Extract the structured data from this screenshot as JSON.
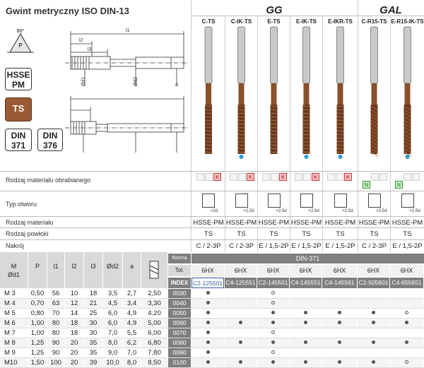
{
  "title": "Gwint metryczny ISO DIN-13",
  "badges": {
    "material": "HSSE\nPM",
    "coating": "TS",
    "din_a": "DIN\n371",
    "din_b": "DIN\n376"
  },
  "diagram_labels": {
    "angle": "60°",
    "pitch": "P",
    "l1": "l1",
    "l2": "l2",
    "l3": "l3",
    "d1": "Ød1",
    "d2": "Ød2",
    "a": "a"
  },
  "groups": [
    {
      "label": "GG"
    },
    {
      "label": "GAL"
    }
  ],
  "columns": [
    {
      "code": "C-TS",
      "material": "HSSE-PM",
      "coating": "TS",
      "lead": "C / 2-3P",
      "hole": "<2d",
      "mats": [
        "",
        "",
        "K"
      ]
    },
    {
      "code": "C-IK-TS",
      "material": "HSSE-PM",
      "coating": "TS",
      "lead": "C / 2-3P",
      "hole": "<2,5d",
      "mats": [
        "",
        "",
        "K"
      ]
    },
    {
      "code": "E-TS",
      "material": "HSSE-PM",
      "coating": "TS",
      "lead": "E / 1,5-2P",
      "hole": "<2,5d",
      "mats": [
        "",
        "",
        "K"
      ]
    },
    {
      "code": "E-IK-TS",
      "material": "HSSE-PM",
      "coating": "TS",
      "lead": "E / 1,5-2P",
      "hole": "<2,5d",
      "mats": [
        "",
        "",
        "K"
      ]
    },
    {
      "code": "E-IKR-TS",
      "material": "HSSE-PM",
      "coating": "TS",
      "lead": "E / 1,5-2P",
      "hole": "<2,5d",
      "mats": [
        "",
        "",
        "K"
      ]
    },
    {
      "code": "C-R15-TS",
      "material": "HSSE-PM",
      "coating": "TS",
      "lead": "C / 2-3P",
      "hole": "<2,5d",
      "mats": [
        "N",
        "",
        ""
      ]
    },
    {
      "code": "E-R15-IK-TS",
      "material": "HSSE-PM",
      "coating": "TS",
      "lead": "E / 1,5-2P",
      "hole": "<2,5d",
      "mats": [
        "N",
        "",
        ""
      ]
    }
  ],
  "row_labels": {
    "material_group": "Rodzaj materiału obrabianego",
    "hole_type": "Typ otworu",
    "tool_material": "Rodzaj materiału",
    "coating": "Rodzaj powłoki",
    "lead": "Nakrój"
  },
  "table": {
    "headers": [
      "M\nØd1",
      "P",
      "l1",
      "l2",
      "l3",
      "Ød2",
      "a"
    ],
    "norma_label": "Norma",
    "norma_value": "DIN-371",
    "tol_label": "Tol.",
    "tol_values": [
      "6HX",
      "6HX",
      "6HX",
      "6HX",
      "6HX",
      "6HX",
      "6HX"
    ],
    "index_label": "INDEX",
    "index_values": [
      "C2-125501",
      "C4-125551",
      "C2-145501",
      "C4-145551",
      "C4-145561",
      "C2-505601",
      "C4-655651"
    ],
    "rows": [
      {
        "m": "M 3",
        "p": "0,50",
        "l1": "56",
        "l2": "10",
        "l3": "18",
        "d2": "3,5",
        "a": "2,7",
        "drill": "2,50",
        "code": "0030",
        "avail": [
          "dot",
          "",
          "circ",
          "",
          "",
          "",
          ""
        ]
      },
      {
        "m": "M 4",
        "p": "0,70",
        "l1": "63",
        "l2": "12",
        "l3": "21",
        "d2": "4,5",
        "a": "3,4",
        "drill": "3,30",
        "code": "0040",
        "avail": [
          "dot",
          "",
          "circ",
          "",
          "",
          "",
          ""
        ]
      },
      {
        "m": "M 5",
        "p": "0,80",
        "l1": "70",
        "l2": "14",
        "l3": "25",
        "d2": "6,0",
        "a": "4,9",
        "drill": "4,20",
        "code": "0050",
        "avail": [
          "dot",
          "",
          "dot",
          "dot",
          "dot",
          "dot",
          "circ"
        ]
      },
      {
        "m": "M 6",
        "p": "1,00",
        "l1": "80",
        "l2": "18",
        "l3": "30",
        "d2": "6,0",
        "a": "4,9",
        "drill": "5,00",
        "code": "0060",
        "avail": [
          "dot",
          "dot",
          "dot",
          "dot",
          "dot",
          "dot",
          "dot"
        ]
      },
      {
        "m": "M 7",
        "p": "1,00",
        "l1": "80",
        "l2": "18",
        "l3": "30",
        "d2": "7,0",
        "a": "5,5",
        "drill": "6,00",
        "code": "0070",
        "avail": [
          "dot",
          "",
          "circ",
          "",
          "",
          "",
          ""
        ]
      },
      {
        "m": "M 8",
        "p": "1,25",
        "p2": "",
        "l1": "90",
        "l2": "20",
        "l3": "35",
        "d2": "8,0",
        "a": "6,2",
        "drill": "6,80",
        "code": "0080",
        "avail": [
          "dot",
          "dot",
          "dot",
          "dot",
          "dot",
          "dot",
          "dot"
        ]
      },
      {
        "m": "M 9",
        "p": "1,25",
        "l1": "90",
        "l2": "20",
        "l3": "35",
        "d2": "9,0",
        "a": "7,0",
        "drill": "7,80",
        "code": "0090",
        "avail": [
          "dot",
          "",
          "circ",
          "",
          "",
          "",
          ""
        ]
      },
      {
        "m": "M10",
        "p": "1,50",
        "l1": "100",
        "l2": "20",
        "l3": "39",
        "d2": "10,0",
        "a": "8,0",
        "drill": "8,50",
        "code": "0100",
        "avail": [
          "dot",
          "dot",
          "dot",
          "dot",
          "dot",
          "dot",
          "circ"
        ]
      }
    ]
  },
  "colors": {
    "tool_bronze": "#8a4f2b",
    "shank": "#c9c9c9",
    "header_dark": "#7f7f7f",
    "header_gray": "#d9d9d9",
    "index_highlight": "#2e5fa8",
    "coolant_blue": "#2a9fd8"
  }
}
